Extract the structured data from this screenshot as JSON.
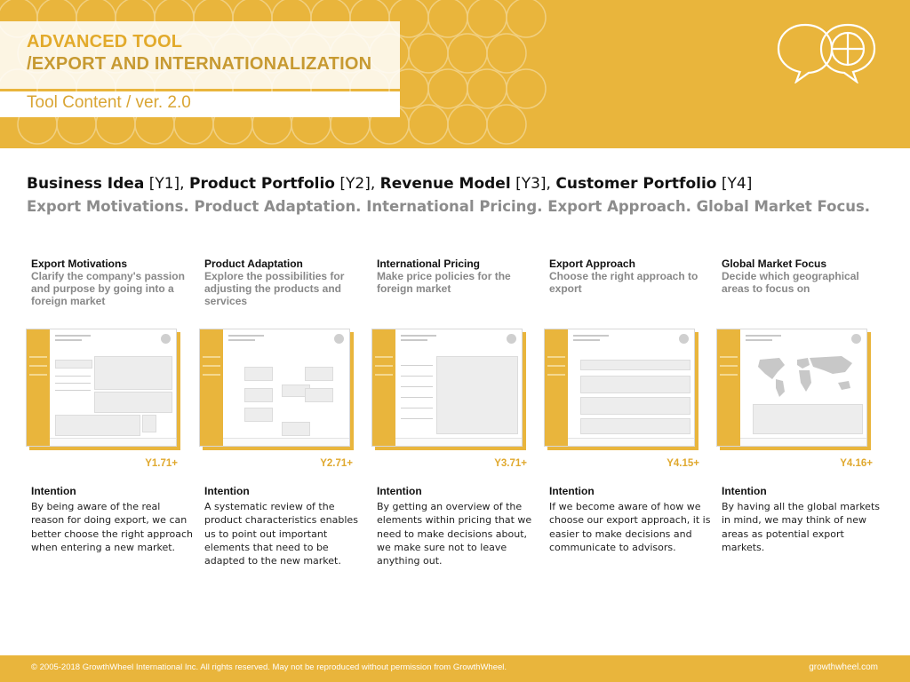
{
  "header": {
    "title_line1": "ADVANCED TOOL",
    "title_line2": "/EXPORT AND INTERNATIONALIZATION",
    "subtitle": "Tool Content / ver. 2.0",
    "logo_icon": "speech-bubbles-wheel-icon",
    "accent_color": "#e9b53c"
  },
  "headline": {
    "parts": [
      {
        "name": "Business Idea",
        "code": "[Y1]"
      },
      {
        "name": "Product Portfolio",
        "code": "[Y2]"
      },
      {
        "name": "Revenue Model",
        "code": "[Y3]"
      },
      {
        "name": "Customer Portfolio",
        "code": "[Y4]"
      }
    ],
    "subheadline": "Export Motivations. Product Adaptation. International Pricing. Export Approach. Global Market Focus."
  },
  "columns": [
    {
      "title": "Export Motivations",
      "description": "Clarify the company's passion and purpose by going into a foreign market",
      "code": "Y1.71+",
      "intention_label": "Intention",
      "intention": "By being aware of the real reason for doing export, we can better choose the right approach when entering a new market."
    },
    {
      "title": "Product Adaptation",
      "description": "Explore the possibilities for adjusting the products and services",
      "code": "Y2.71+",
      "intention_label": "Intention",
      "intention": "A systematic review of the product characteristics enables us to point out important elements that need to be adapted to the new market."
    },
    {
      "title": "International Pricing",
      "description": "Make price policies for the foreign market",
      "code": "Y3.71+",
      "intention_label": "Intention",
      "intention": "By getting an overview of the elements within pricing that we need to make decisions about, we make sure not to leave anything out."
    },
    {
      "title": "Export Approach",
      "description": "Choose the right approach to export",
      "code": "Y4.15+",
      "intention_label": "Intention",
      "intention": "If we become aware of how we choose our export approach, it is easier to make decisions and communicate to advisors."
    },
    {
      "title": "Global Market Focus",
      "description": "Decide which geographical areas to focus on",
      "code": "Y4.16+",
      "intention_label": "Intention",
      "intention": "By having all the global markets in mind, we may think of new areas as potential export markets."
    }
  ],
  "footer": {
    "copyright": "© 2005-2018 GrowthWheel International Inc. All rights reserved. May not be reproduced without permission from GrowthWheel.",
    "website": "growthwheel.com"
  }
}
